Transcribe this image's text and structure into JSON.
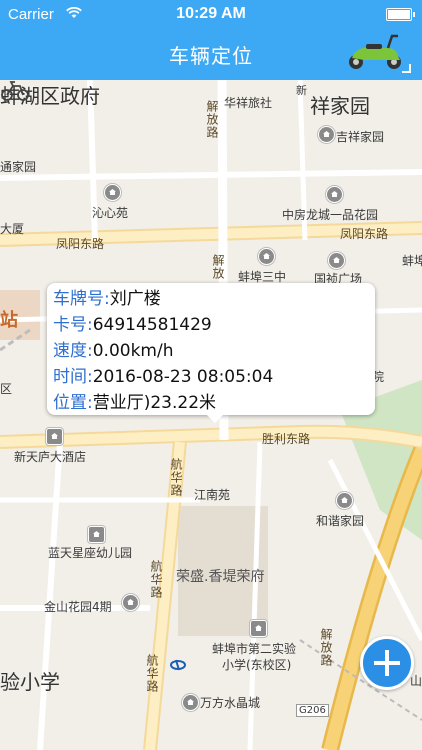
{
  "status": {
    "carrier": "Carrier",
    "time": "10:29 AM"
  },
  "nav": {
    "title": "车辆定位"
  },
  "info": {
    "plate_key": "车牌号:",
    "plate_val": "刘广楼",
    "card_key": "卡号:",
    "card_val": "64914581429",
    "speed_key": "速度:",
    "speed_val": "0.00km/h",
    "time_key": "时间:",
    "time_val": "2016-08-23 08:05:04",
    "pos_key": "位置:",
    "pos_val": "营业厅)23.22米"
  },
  "map": {
    "labels": {
      "district": "蚌湖区政府",
      "jiayuan": "祥家园",
      "huaxiang": "华祥旅社",
      "jixiang": "吉祥家园",
      "tongjiayuan": "通家园",
      "qinshuiyuan": "沁心苑",
      "zhongfang": "中房龙城一品花园",
      "dasha": "大厦",
      "fengyang1": "凤阳东路",
      "fengyang2": "凤阳东路",
      "bengbu3": "蚌埠三中",
      "guoqi": "国祯广场",
      "bengbu_right": "蚌埠",
      "station": "站",
      "district2": "区",
      "yuan": "院",
      "xintianhu": "新天庐大酒店",
      "shengli": "胜利东路",
      "jiangnan": "江南苑",
      "hexie": "和谐家园",
      "lantian": "蓝天星座幼儿园",
      "rongsheng": "荣盛.香堤荣府",
      "jinshan": "金山花园4期",
      "shiyan": "蚌埠市第二实验",
      "shiyan2": "小学(东校区)",
      "xiaoxue": "验小学",
      "wanfang": "万方水晶城",
      "g206": "G206",
      "hh_top": "华祥旅社",
      "jiefang1": "解放路",
      "jiefang2": "解放",
      "jiefang3": "解放路",
      "hanghua1": "航华路",
      "hanghua2": "航华路",
      "hanghua3": "航华路",
      "shan": "山",
      "xin": "新"
    }
  },
  "colors": {
    "bar": "#3da9f4",
    "key": "#2f6fd0",
    "add": "#2b8fe6"
  }
}
